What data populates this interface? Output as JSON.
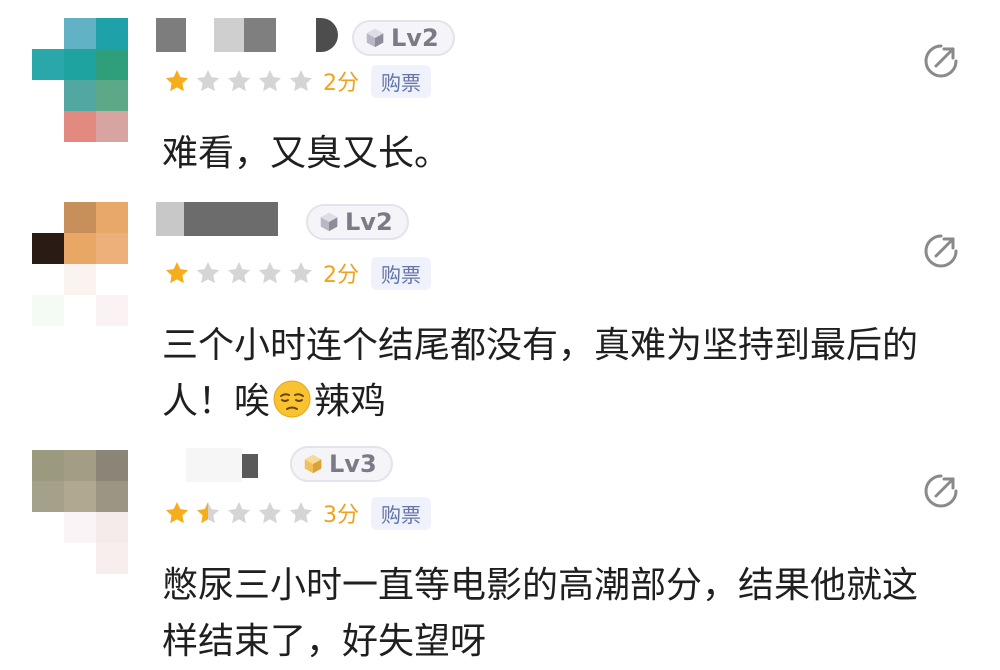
{
  "colors": {
    "star_filled": "#f6ad1b",
    "star_empty": "#d5d5d5",
    "score": "#f0a21c",
    "purchase_tag_text": "#6474a6",
    "purchase_tag_bg": "#eff2fa",
    "level_text": "#7b7a86",
    "text": "#1f1f1f"
  },
  "comments": [
    {
      "level": "Lv2",
      "stars": 1,
      "score": "2分",
      "purchase_tag": "购票",
      "text": "难看，又臭又长。",
      "share_icon": "share-icon"
    },
    {
      "level": "Lv2",
      "stars": 1,
      "score": "2分",
      "purchase_tag": "购票",
      "text_before_emoji": "三个小时连个结尾都没有，真难为坚持到最后的人！唉",
      "emoji": "pensive-face-emoji",
      "text_after_emoji": "辣鸡",
      "share_icon": "share-icon"
    },
    {
      "level": "Lv3",
      "stars": 1.5,
      "score": "3分",
      "purchase_tag": "购票",
      "text": "憋尿三小时一直等电影的高潮部分，结果他就这样结束了，好失望呀",
      "share_icon": "share-icon"
    }
  ]
}
